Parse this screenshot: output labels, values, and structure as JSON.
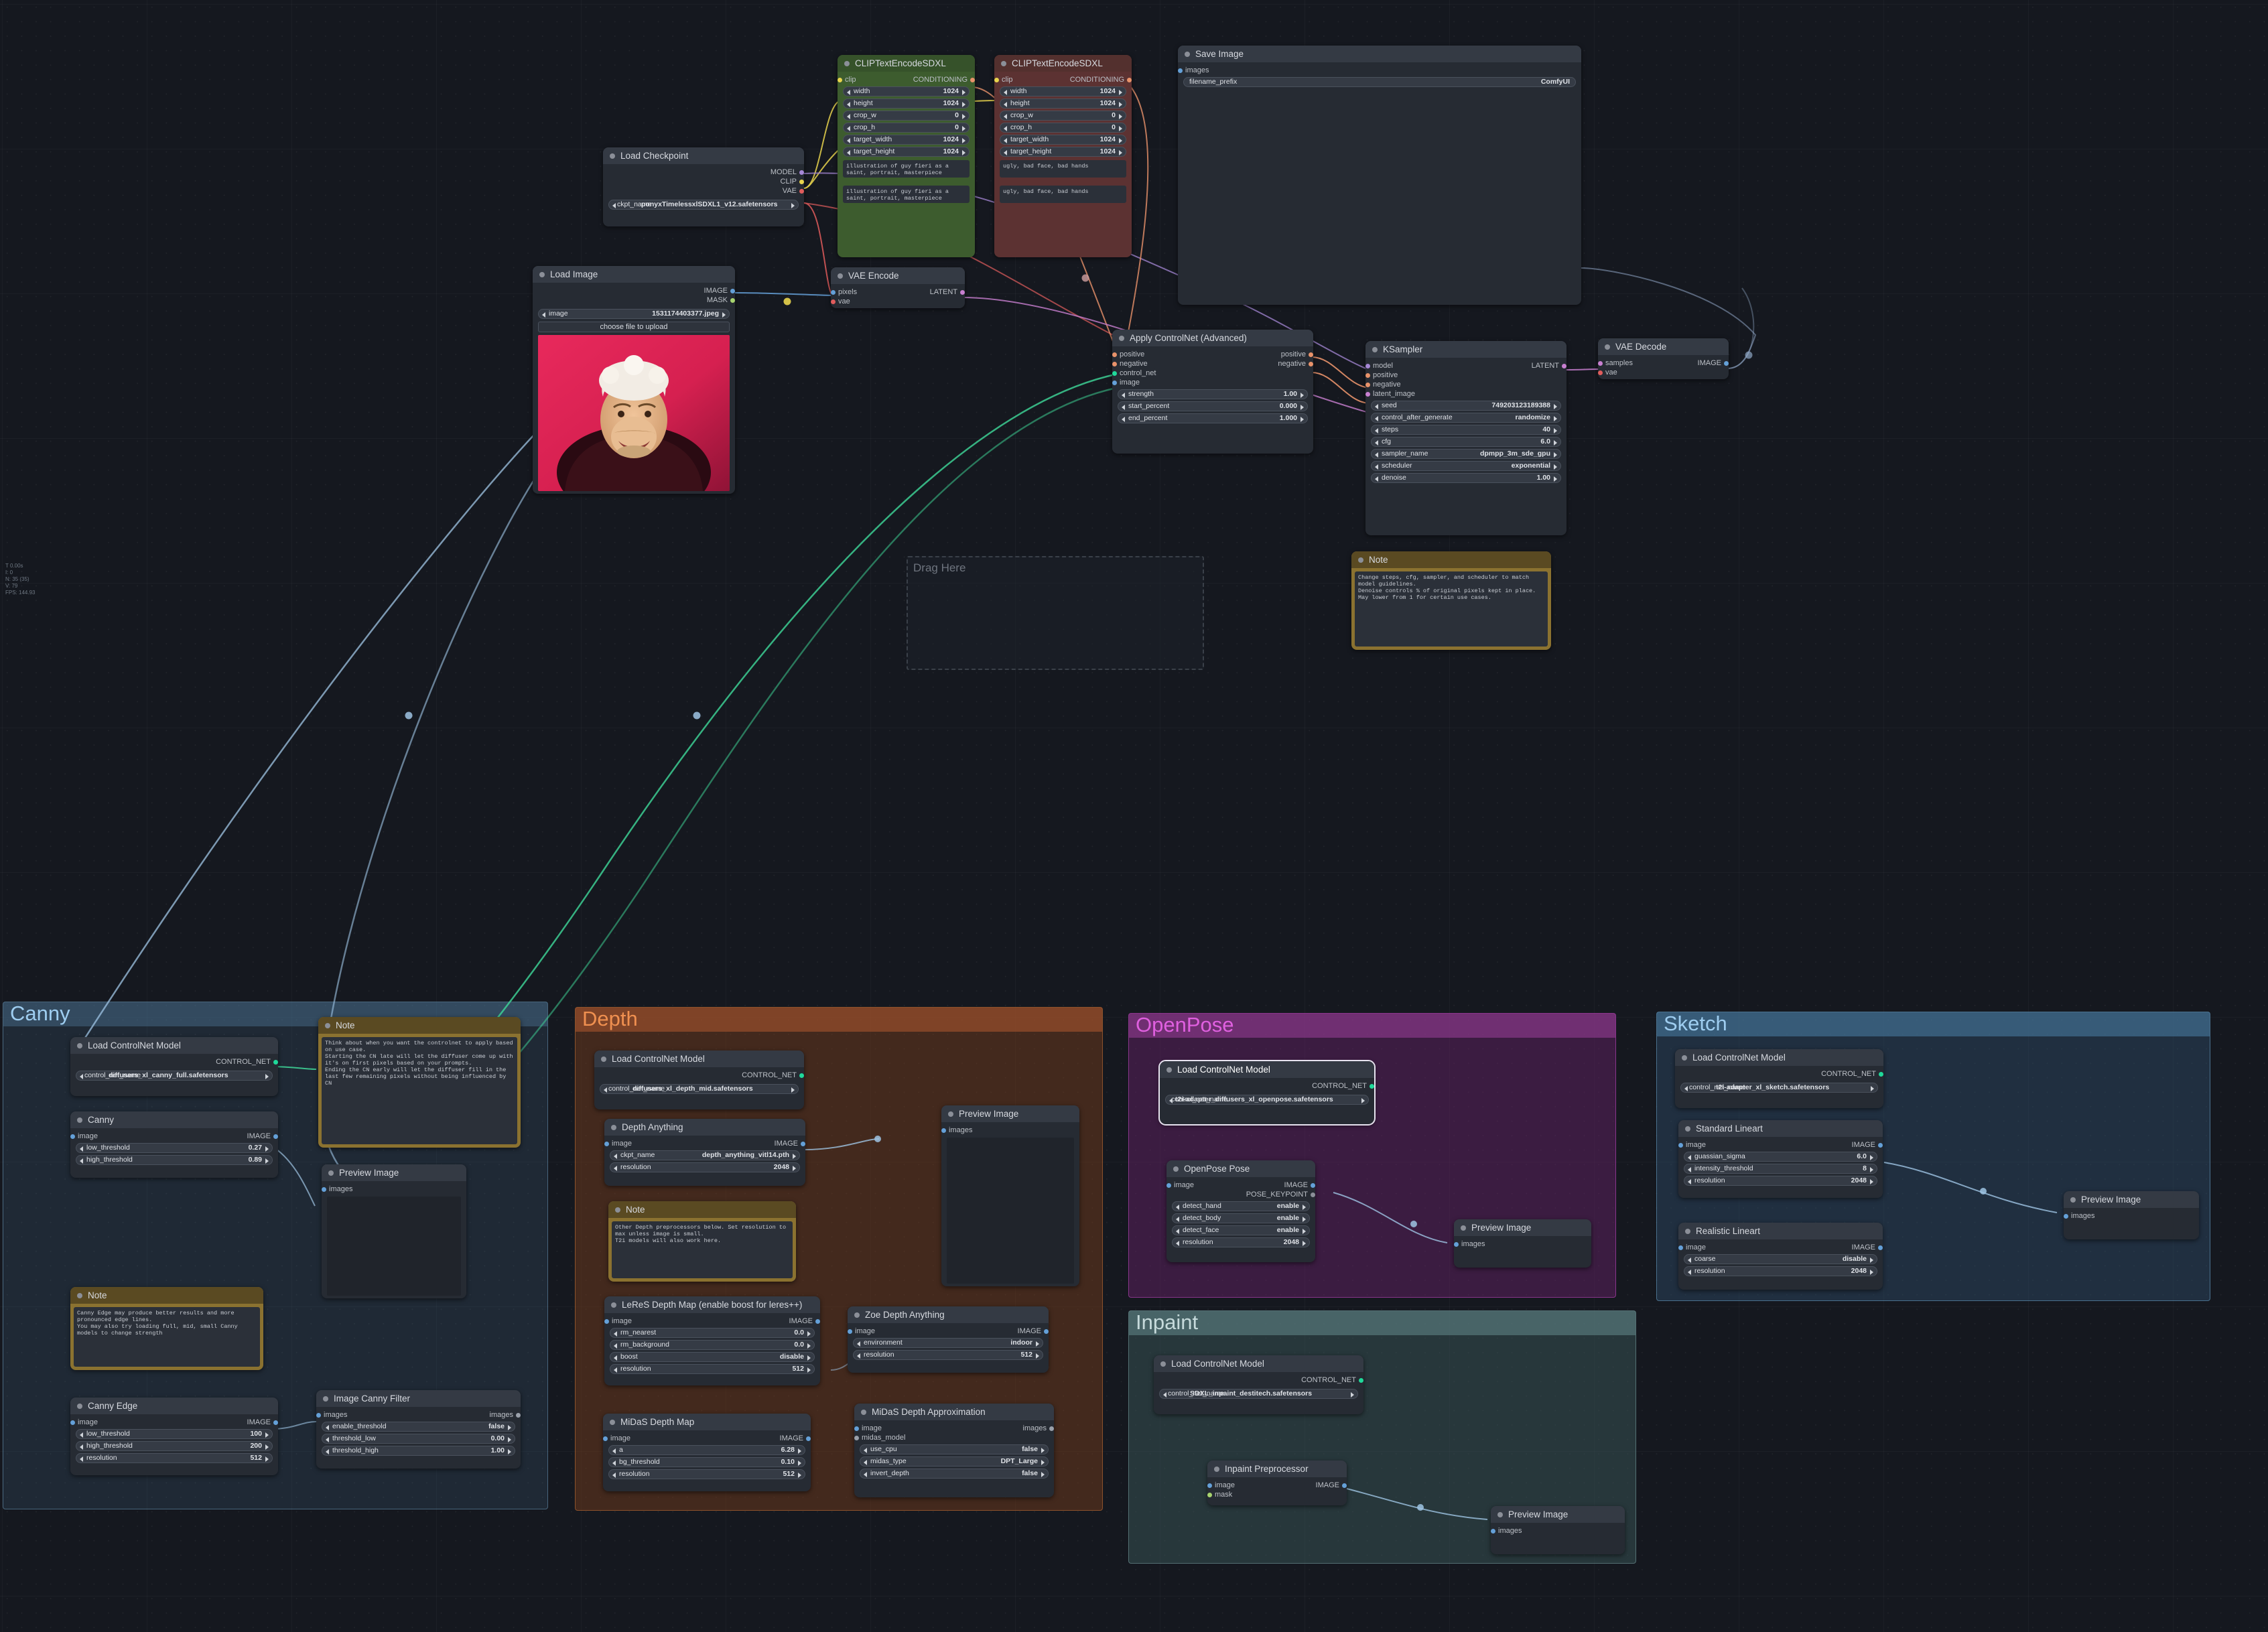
{
  "app": {
    "name": "ComfyUI",
    "canvas_label": "workflow-graph"
  },
  "perf_overlay": {
    "lines": [
      "T 0.00s",
      "I: 0",
      "N: 35 (35)",
      "V: 79",
      "FPS: 144.93"
    ]
  },
  "drag_panel": {
    "label": "Drag Here"
  },
  "groups": [
    {
      "title": "Canny",
      "color": "#4f7a9b"
    },
    {
      "title": "Depth",
      "color": "#a0522d"
    },
    {
      "title": "OpenPose",
      "color": "#8e3a8e"
    },
    {
      "title": "Sketch",
      "color": "#4a7fa5"
    },
    {
      "title": "Inpaint",
      "color": "#5b7d80"
    }
  ],
  "nodes": {
    "load_checkpoint": {
      "title": "Load Checkpoint",
      "outputs": [
        "MODEL",
        "CLIP",
        "VAE"
      ],
      "widgets": [
        {
          "name": "ckpt_name",
          "value": "ponyxTimelessxlSDXL1_v12.safetensors"
        }
      ]
    },
    "clip_positive": {
      "title": "CLIPTextEncodeSDXL",
      "input": "clip",
      "output": "CONDITIONING",
      "widgets": [
        {
          "name": "width",
          "value": "1024"
        },
        {
          "name": "height",
          "value": "1024"
        },
        {
          "name": "crop_w",
          "value": "0"
        },
        {
          "name": "crop_h",
          "value": "0"
        },
        {
          "name": "target_width",
          "value": "1024"
        },
        {
          "name": "target_height",
          "value": "1024"
        }
      ],
      "text_g": "illustration of guy fieri as a saint, portrait, masterpiece",
      "text_l": "illustration of guy fieri as a saint, portrait, masterpiece"
    },
    "clip_negative": {
      "title": "CLIPTextEncodeSDXL",
      "input": "clip",
      "output": "CONDITIONING",
      "widgets": [
        {
          "name": "width",
          "value": "1024"
        },
        {
          "name": "height",
          "value": "1024"
        },
        {
          "name": "crop_w",
          "value": "0"
        },
        {
          "name": "crop_h",
          "value": "0"
        },
        {
          "name": "target_width",
          "value": "1024"
        },
        {
          "name": "target_height",
          "value": "1024"
        }
      ],
      "text_g": "ugly, bad face, bad hands",
      "text_l": "ugly, bad face, bad hands"
    },
    "save_image": {
      "title": "Save Image",
      "input": "images",
      "widgets": [
        {
          "name": "filename_prefix",
          "value": "ComfyUI"
        }
      ]
    },
    "load_image": {
      "title": "Load Image",
      "outputs": [
        "IMAGE",
        "MASK"
      ],
      "widgets": [
        {
          "name": "image",
          "value": "1531174403377.jpeg"
        }
      ],
      "button": "choose file to upload"
    },
    "vae_encode": {
      "title": "VAE Encode",
      "inputs": [
        "pixels",
        "vae"
      ],
      "output": "LATENT"
    },
    "apply_controlnet": {
      "title": "Apply ControlNet (Advanced)",
      "inputs": [
        "positive",
        "negative",
        "control_net",
        "image"
      ],
      "outputs": [
        "positive",
        "negative"
      ],
      "widgets": [
        {
          "name": "strength",
          "value": "1.00"
        },
        {
          "name": "start_percent",
          "value": "0.000"
        },
        {
          "name": "end_percent",
          "value": "1.000"
        }
      ]
    },
    "ksampler": {
      "title": "KSampler",
      "inputs": [
        "model",
        "positive",
        "negative",
        "latent_image"
      ],
      "output": "LATENT",
      "widgets": [
        {
          "name": "seed",
          "value": "749203123189388"
        },
        {
          "name": "control_after_generate",
          "value": "randomize"
        },
        {
          "name": "steps",
          "value": "40"
        },
        {
          "name": "cfg",
          "value": "6.0"
        },
        {
          "name": "sampler_name",
          "value": "dpmpp_3m_sde_gpu"
        },
        {
          "name": "scheduler",
          "value": "exponential"
        },
        {
          "name": "denoise",
          "value": "1.00"
        }
      ]
    },
    "vae_decode": {
      "title": "VAE Decode",
      "inputs": [
        "samples",
        "vae"
      ],
      "output": "IMAGE"
    },
    "note_ksampler": {
      "title": "Note",
      "text": "Change steps, cfg, sampler, and scheduler to match model guidelines.\nDenoise controls % of original pixels kept in place. May lower from 1 for certain use cases."
    },
    "canny_loader": {
      "title": "Load ControlNet Model",
      "output": "CONTROL_NET",
      "widgets": [
        {
          "name": "control_net_name",
          "value": "diffusers_xl_canny_full.safetensors"
        }
      ]
    },
    "canny": {
      "title": "Canny",
      "input": "image",
      "output": "IMAGE",
      "widgets": [
        {
          "name": "low_threshold",
          "value": "0.27"
        },
        {
          "name": "high_threshold",
          "value": "0.89"
        }
      ]
    },
    "note_canny_timing": {
      "title": "Note",
      "text": "Think about when you want the controlnet to apply based on use case.\nStarting the CN late will let the diffuser come up with it's on first pixels based on your prompts.\nEnding the CN early will let the diffuser fill in the last few remaining pixels without being influenced by CN"
    },
    "canny_preview": {
      "title": "Preview Image",
      "input": "images"
    },
    "note_canny_edge": {
      "title": "Note",
      "text": "Canny Edge may produce better results and more pronounced edge lines.\nYou may also try loading full, mid, small Canny models to change strength"
    },
    "canny_edge": {
      "title": "Canny Edge",
      "input": "image",
      "output": "IMAGE",
      "widgets": [
        {
          "name": "low_threshold",
          "value": "100"
        },
        {
          "name": "high_threshold",
          "value": "200"
        },
        {
          "name": "resolution",
          "value": "512"
        }
      ]
    },
    "image_canny_filter": {
      "title": "Image Canny Filter",
      "input": "images",
      "output": "images",
      "widgets": [
        {
          "name": "enable_threshold",
          "value": "false"
        },
        {
          "name": "threshold_low",
          "value": "0.00"
        },
        {
          "name": "threshold_high",
          "value": "1.00"
        }
      ]
    },
    "depth_loader": {
      "title": "Load ControlNet Model",
      "output": "CONTROL_NET",
      "widgets": [
        {
          "name": "control_net_name",
          "value": "diffusers_xl_depth_mid.safetensors"
        }
      ]
    },
    "depth_anything": {
      "title": "Depth Anything",
      "input": "image",
      "output": "IMAGE",
      "widgets": [
        {
          "name": "ckpt_name",
          "value": "depth_anything_vitl14.pth"
        },
        {
          "name": "resolution",
          "value": "2048"
        }
      ]
    },
    "note_depth": {
      "title": "Note",
      "text": "Other Depth preprocessors below. Set resolution to max unless image is small.\nT2i models will also work here."
    },
    "depth_preview": {
      "title": "Preview Image",
      "input": "images"
    },
    "leres": {
      "title": "LeReS Depth Map (enable boost for leres++)",
      "input": "image",
      "output": "IMAGE",
      "widgets": [
        {
          "name": "rm_nearest",
          "value": "0.0"
        },
        {
          "name": "rm_background",
          "value": "0.0"
        },
        {
          "name": "boost",
          "value": "disable"
        },
        {
          "name": "resolution",
          "value": "512"
        }
      ]
    },
    "zoe": {
      "title": "Zoe Depth Anything",
      "input": "image",
      "output": "IMAGE",
      "widgets": [
        {
          "name": "environment",
          "value": "indoor"
        },
        {
          "name": "resolution",
          "value": "512"
        }
      ]
    },
    "midas_depth_map": {
      "title": "MiDaS Depth Map",
      "input": "image",
      "output": "IMAGE",
      "widgets": [
        {
          "name": "a",
          "value": "6.28"
        },
        {
          "name": "bg_threshold",
          "value": "0.10"
        },
        {
          "name": "resolution",
          "value": "512"
        }
      ]
    },
    "midas_approx": {
      "title": "MiDaS Depth Approximation",
      "inputs": [
        "image",
        "midas_model"
      ],
      "output": "images",
      "widgets": [
        {
          "name": "use_cpu",
          "value": "false"
        },
        {
          "name": "midas_type",
          "value": "DPT_Large"
        },
        {
          "name": "invert_depth",
          "value": "false"
        }
      ]
    },
    "openpose_loader": {
      "title": "Load ControlNet Model",
      "output": "CONTROL_NET",
      "widgets": [
        {
          "name": "t2i-adapter_diffusers_xl_openpose.safetensors",
          "value": ""
        }
      ],
      "widget_name": "control_net_name",
      "widget_value": "t2i-adapter_diffusers_xl_openpose.safetensors",
      "selected": true
    },
    "openpose_pose": {
      "title": "OpenPose Pose",
      "input": "image",
      "outputs": [
        "IMAGE",
        "POSE_KEYPOINT"
      ],
      "widgets": [
        {
          "name": "detect_hand",
          "value": "enable"
        },
        {
          "name": "detect_body",
          "value": "enable"
        },
        {
          "name": "detect_face",
          "value": "enable"
        },
        {
          "name": "resolution",
          "value": "2048"
        }
      ]
    },
    "openpose_preview": {
      "title": "Preview Image",
      "input": "images"
    },
    "sketch_loader": {
      "title": "Load ControlNet Model",
      "output": "CONTROL_NET",
      "widgets": [
        {
          "name": "control_net_name",
          "value": "t2i-adapter_xl_sketch.safetensors"
        }
      ]
    },
    "standard_lineart": {
      "title": "Standard Lineart",
      "input": "image",
      "output": "IMAGE",
      "widgets": [
        {
          "name": "guassian_sigma",
          "value": "6.0"
        },
        {
          "name": "intensity_threshold",
          "value": "8"
        },
        {
          "name": "resolution",
          "value": "2048"
        }
      ]
    },
    "realistic_lineart": {
      "title": "Realistic Lineart",
      "input": "image",
      "output": "IMAGE",
      "widgets": [
        {
          "name": "coarse",
          "value": "disable"
        },
        {
          "name": "resolution",
          "value": "2048"
        }
      ]
    },
    "sketch_preview": {
      "title": "Preview Image",
      "input": "images"
    },
    "inpaint_loader": {
      "title": "Load ControlNet Model",
      "output": "CONTROL_NET",
      "widgets": [
        {
          "name": "control_net_name",
          "value": "SDXL_inpaint_destitech.safetensors"
        }
      ]
    },
    "inpaint_preproc": {
      "title": "Inpaint Preprocessor",
      "inputs": [
        "image",
        "mask"
      ],
      "output": "IMAGE"
    },
    "inpaint_preview": {
      "title": "Preview Image",
      "input": "images"
    }
  }
}
